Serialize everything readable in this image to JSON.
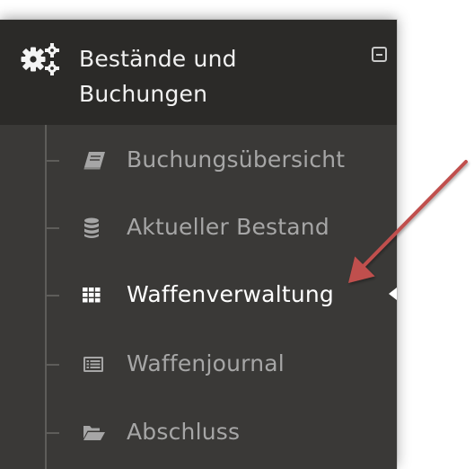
{
  "header": {
    "title": "Bestände und\nBuchungen",
    "icon": "cogs-icon",
    "collapse_icon": "collapse-minus-icon"
  },
  "nav": {
    "items": [
      {
        "label": "Buchungsübersicht",
        "icon": "book-icon",
        "active": false
      },
      {
        "label": "Aktueller Bestand",
        "icon": "database-icon",
        "active": false
      },
      {
        "label": "Waffenverwaltung",
        "icon": "grid-icon",
        "active": true
      },
      {
        "label": "Waffenjournal",
        "icon": "list-alt-icon",
        "active": false
      },
      {
        "label": "Abschluss",
        "icon": "folder-open-icon",
        "active": false
      }
    ]
  },
  "annotation": {
    "icon": "pointer-arrow-icon",
    "color": "#c0504d"
  },
  "colors": {
    "panel_bg": "#3a3937",
    "header_bg": "#2b2a28",
    "text_inactive": "#a6a6a6",
    "text_active": "#ffffff"
  }
}
